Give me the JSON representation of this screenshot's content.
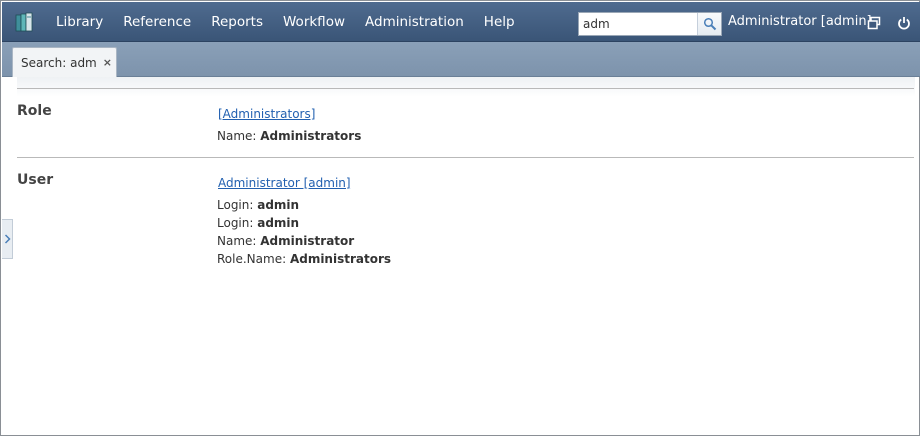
{
  "menu": [
    "Library",
    "Reference",
    "Reports",
    "Workflow",
    "Administration",
    "Help"
  ],
  "search": {
    "value": "adm"
  },
  "user": {
    "label": "Administrator [admin]"
  },
  "tab": {
    "label": "Search: adm",
    "close": "×"
  },
  "results": {
    "role": {
      "title": "Role",
      "link": "[Administrators]",
      "fields": [
        {
          "label": "Name: ",
          "value": "Administrators"
        }
      ]
    },
    "user": {
      "title": "User",
      "link": "Administrator [admin]",
      "fields": [
        {
          "label": "Login: ",
          "value": "admin"
        },
        {
          "label": "Login: ",
          "value": "admin"
        },
        {
          "label": "Name: ",
          "value": "Administrator"
        },
        {
          "label": "Role.Name: ",
          "value": "Administrators"
        }
      ]
    }
  },
  "colors": {
    "topbar": "#3f5a7e",
    "tabstrip": "#8296ae",
    "link": "#2260b0"
  },
  "icons": [
    "app-logo-icon",
    "search-icon",
    "window-restore-icon",
    "power-icon",
    "chevron-right-icon"
  ]
}
